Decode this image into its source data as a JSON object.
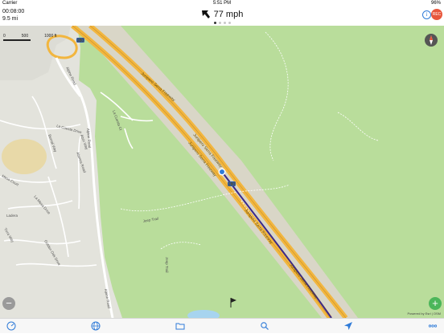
{
  "status_bar": {
    "carrier": "Carrier",
    "clock": "5:51 PM",
    "battery": "96%"
  },
  "header": {
    "elapsed_time": "00:08:00",
    "distance": "9.5 mi",
    "speed": "77 mph",
    "info_label": "i",
    "record_label": "REC",
    "page_count": 4,
    "active_page": 0
  },
  "map": {
    "scale_labels": [
      "0",
      "500",
      "1000 ft"
    ],
    "highway_shield": "280",
    "road_labels": [
      "Junipero Serra Freeway",
      "Junipero Serra Freeway",
      "Junipero Serra Freeway",
      "Junipero Serra Freeway",
      "Junipero Serra Freeway"
    ],
    "street_labels": [
      "Alpine Road",
      "Alpine Road",
      "Alpine Road",
      "Jeep Trail",
      "Jeep Trail",
      "La Cuesta Drive",
      "La Mesa Drive",
      "Ladera",
      "Golden Oak Drive",
      "Mesa Court",
      "Alamos Road",
      "Alsin Way",
      "Bernal Way",
      "Tivra Way",
      "La Cuesta Ct"
    ],
    "attribution": "Powered by Esri | OSM"
  },
  "controls": {
    "zoom_out_label": "−",
    "zoom_in_label": "+"
  },
  "tab_bar": {
    "icons": [
      "speedometer-icon",
      "globe-icon",
      "folder-icon",
      "search-icon",
      "location-arrow-icon",
      "more-icon"
    ]
  },
  "colors": {
    "park_green": "#b9dd9b",
    "urban_gray": "#e2e2dc",
    "highway_orange": "#f2b63f",
    "track_purple": "#3b2a8a",
    "accent_blue": "#2f7bd8",
    "record_red": "#e8573d"
  }
}
